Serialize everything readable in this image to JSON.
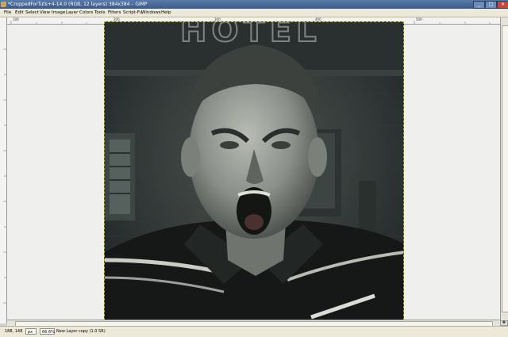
{
  "window": {
    "title": "*CroppedForTuts+4-14.0 (RGB, 12 layers) 384x384 – GIMP",
    "minimize": "_",
    "maximize": "□",
    "close": "✕"
  },
  "menubar": {
    "items": [
      "File",
      "Edit",
      "Select",
      "View",
      "Image",
      "Layer",
      "Colors",
      "Tools",
      "Filters",
      "Script-Fu",
      "Windows",
      "Help"
    ]
  },
  "rulers": {
    "top_labels": [
      "100",
      "200",
      "300",
      "400",
      "500"
    ]
  },
  "photo": {
    "sign_text": "HOTEL",
    "description_icon": "photo-of-shouting-man"
  },
  "status": {
    "coords": "188, 148",
    "unit": "px",
    "zoom": "66.6%",
    "layer_info": "New Layer copy (1.0 SR)"
  },
  "nav_icon": "navigate-icon"
}
